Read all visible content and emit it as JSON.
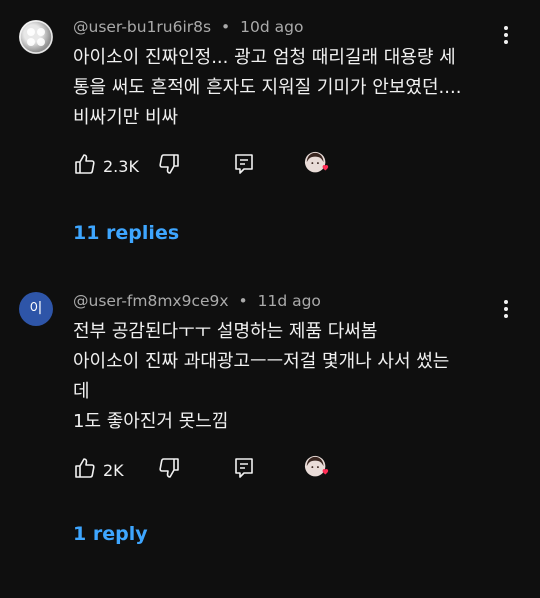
{
  "comments": [
    {
      "author": "@user-bu1ru6ir8s",
      "separator": "•",
      "time": "10d ago",
      "lines": [
        "아이소이 진짜인정... 광고 엄청 때리길래 대용량 세",
        "통을 써도 흔적에 흔자도 지워질 기미가 안보였던....",
        "비싸기만 비싸"
      ],
      "like_count": "2.3K",
      "replies_label": "11 replies"
    },
    {
      "author": "@user-fm8mx9ce9x",
      "separator": "•",
      "time": "11d ago",
      "avatar_letter": "이",
      "lines": [
        "전부 공감된다ㅜㅜ 설명하는 제품 다써봄",
        "아이소이 진짜 과대광고ㅡㅡ저걸 몇개나 사서 썼는",
        "데",
        "1도 좋아진거 못느낌"
      ],
      "like_count": "2K",
      "replies_label": "1 reply"
    }
  ],
  "colors": {
    "link": "#3ea6ff",
    "meta": "#aaaaaa",
    "background": "#0f0f0f",
    "heart": "#ff2d55"
  }
}
